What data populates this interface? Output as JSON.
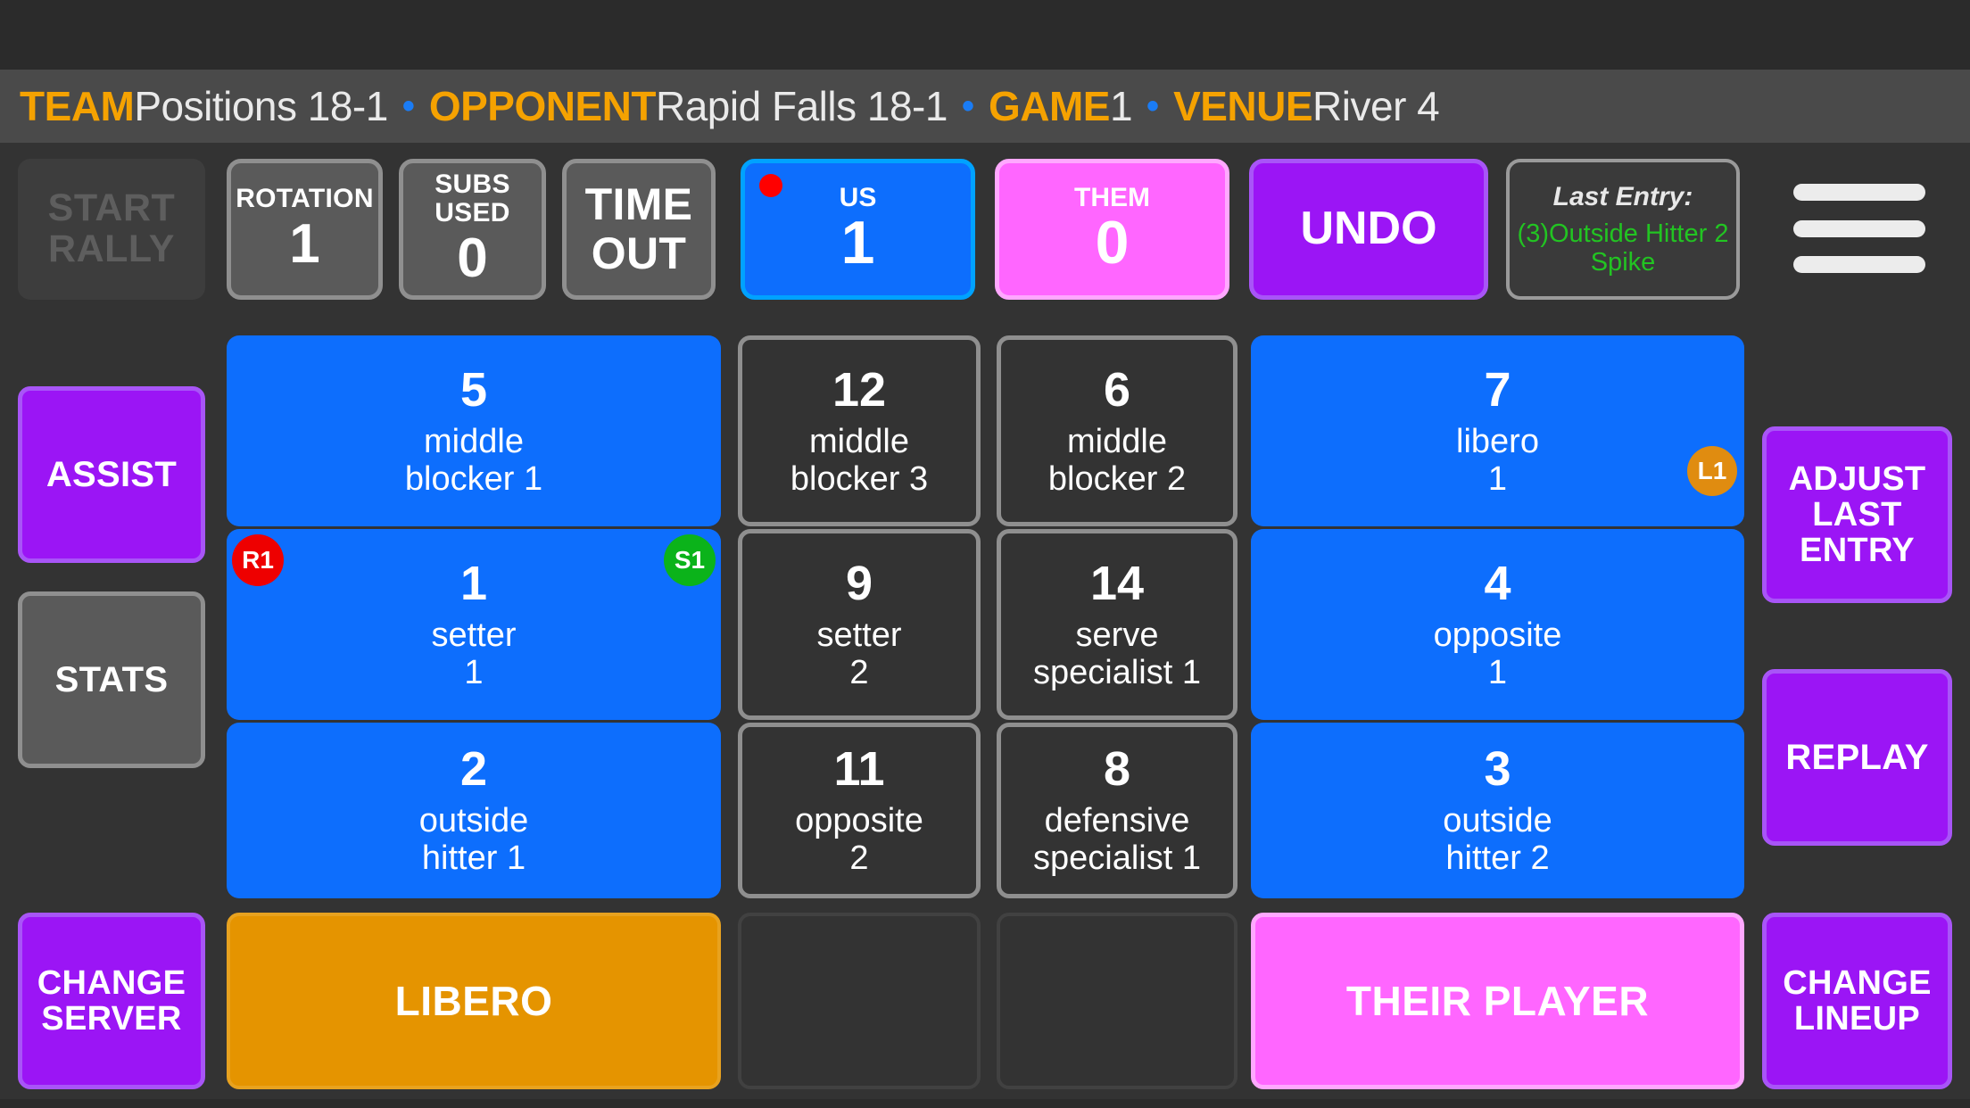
{
  "header": {
    "segments": [
      {
        "key": "TEAM",
        "value": "Positions 18-1"
      },
      {
        "key": "OPPONENT",
        "value": "Rapid Falls 18-1"
      },
      {
        "key": "GAME",
        "value": "1"
      },
      {
        "key": "VENUE",
        "value": "River 4"
      }
    ],
    "separator": "•",
    "key_color": "#f5a201",
    "value_color": "#eaeaea",
    "separator_color": "#1a7cf5"
  },
  "controls": {
    "start_rally_label": "START\nRALLY",
    "start_rally_enabled": false,
    "rotation_caption": "ROTATION",
    "rotation_value": "1",
    "subs_caption": "SUBS\nUSED",
    "subs_value": "0",
    "timeout_label": "TIME\nOUT",
    "us_caption": "US",
    "us_score": "1",
    "them_caption": "THEM",
    "them_score": "0",
    "undo_label": "UNDO",
    "last_entry_title": "Last Entry:",
    "last_entry_value": "(3)Outside Hitter 2\nSpike",
    "last_entry_color": "#22c422",
    "menu_icon": "hamburger-menu-icon"
  },
  "left_sidebar": {
    "assist_label": "ASSIST",
    "stats_label": "STATS",
    "change_server_label": "CHANGE\nSERVER"
  },
  "right_sidebar": {
    "adjust_last_entry_label": "ADJUST\nLAST\nENTRY",
    "replay_label": "REPLAY",
    "change_lineup_label": "CHANGE\nLINEUP"
  },
  "players": {
    "col_a": [
      {
        "number": "5",
        "role": "middle\nblocker 1",
        "on_court": true
      },
      {
        "number": "1",
        "role": "setter\n1",
        "on_court": true,
        "badge_r": "R1",
        "badge_s": "S1"
      },
      {
        "number": "2",
        "role": "outside\nhitter 1",
        "on_court": true
      }
    ],
    "col_b": [
      {
        "number": "12",
        "role": "middle\nblocker 3",
        "on_court": false
      },
      {
        "number": "9",
        "role": "setter\n2",
        "on_court": false
      },
      {
        "number": "11",
        "role": "opposite\n2",
        "on_court": false
      }
    ],
    "col_c": [
      {
        "number": "6",
        "role": "middle\nblocker 2",
        "on_court": false
      },
      {
        "number": "14",
        "role": "serve\nspecialist 1",
        "on_court": false
      },
      {
        "number": "8",
        "role": "defensive\nspecialist 1",
        "on_court": false
      }
    ],
    "col_d": [
      {
        "number": "7",
        "role": "libero\n1",
        "on_court": true,
        "badge_l": "L1"
      },
      {
        "number": "4",
        "role": "opposite\n1",
        "on_court": true
      },
      {
        "number": "3",
        "role": "outside\nhitter 2",
        "on_court": true
      }
    ]
  },
  "bottom": {
    "libero_label": "LIBERO",
    "their_player_label": "THEIR PLAYER",
    "empty_slot_1_label": "",
    "empty_slot_2_label": ""
  },
  "colors": {
    "on_court": "#0d6efd",
    "bench": "#333333",
    "purple": "#9b15f5",
    "pink": "#ff66ff",
    "orange": "#e59400",
    "accent_orange": "#f5a201",
    "badge_red": "#ee0000",
    "badge_green": "#0bb31a",
    "badge_libero": "#e08c10",
    "background": "#333333"
  }
}
